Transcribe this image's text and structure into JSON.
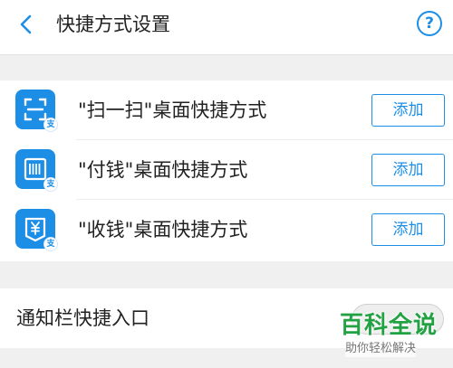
{
  "header": {
    "title": "快捷方式设置",
    "back_icon": "chevron-left-icon",
    "help_icon": "help-circle-icon",
    "help_glyph": "?"
  },
  "shortcuts": [
    {
      "label": "\"扫一扫\"桌面快捷方式",
      "icon": "scan-icon",
      "badge": "支",
      "button": "添加"
    },
    {
      "label": "\"付钱\"桌面快捷方式",
      "icon": "pay-barcode-icon",
      "badge": "支",
      "button": "添加"
    },
    {
      "label": "\"收钱\"桌面快捷方式",
      "icon": "receive-money-icon",
      "badge": "支",
      "button": "添加"
    }
  ],
  "notification": {
    "label": "通知栏快捷入口",
    "toggle_state": "off"
  },
  "watermark": {
    "title": "百科全说",
    "subtitle": "助你轻松解决"
  },
  "colors": {
    "accent": "#1d8ee6",
    "watermark_green": "#23a243",
    "background": "#f0f0f0"
  }
}
